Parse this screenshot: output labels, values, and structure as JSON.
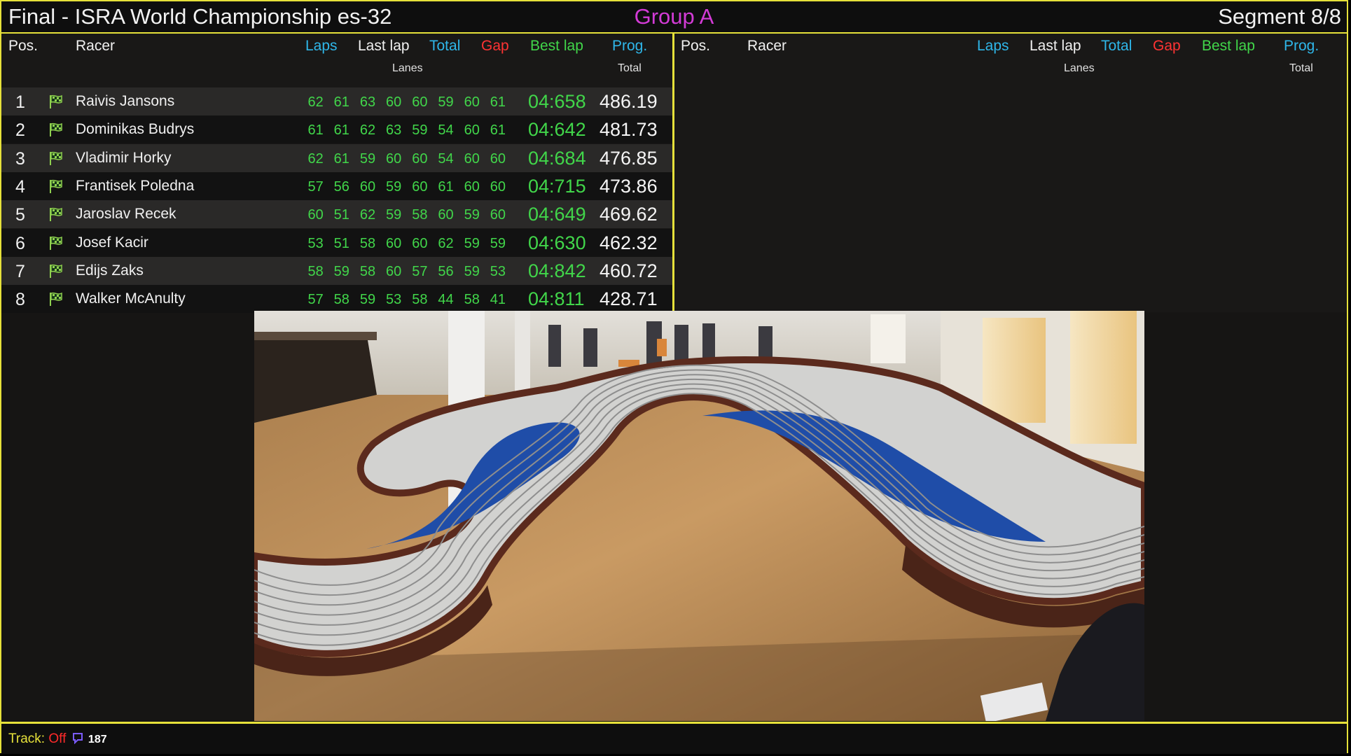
{
  "header": {
    "title": "Final - ISRA World Championship es-32",
    "group": "Group A",
    "segment": "Segment 8/8"
  },
  "columns": {
    "pos": "Pos.",
    "racer": "Racer",
    "laps": "Laps",
    "last_lap": "Last lap",
    "total": "Total",
    "gap": "Gap",
    "best_lap": "Best lap",
    "prog": "Prog.",
    "lanes": "Lanes",
    "prog_total": "Total"
  },
  "racers": [
    {
      "pos": "1",
      "name": "Raivis Jansons",
      "lanes": [
        "62",
        "61",
        "63",
        "60",
        "60",
        "59",
        "60",
        "61"
      ],
      "best_lap": "04:658",
      "total": "486.19"
    },
    {
      "pos": "2",
      "name": "Dominikas Budrys",
      "lanes": [
        "61",
        "61",
        "62",
        "63",
        "59",
        "54",
        "60",
        "61"
      ],
      "best_lap": "04:642",
      "total": "481.73"
    },
    {
      "pos": "3",
      "name": "Vladimir Horky",
      "lanes": [
        "62",
        "61",
        "59",
        "60",
        "60",
        "54",
        "60",
        "60"
      ],
      "best_lap": "04:684",
      "total": "476.85"
    },
    {
      "pos": "4",
      "name": "Frantisek Poledna",
      "lanes": [
        "57",
        "56",
        "60",
        "59",
        "60",
        "61",
        "60",
        "60"
      ],
      "best_lap": "04:715",
      "total": "473.86"
    },
    {
      "pos": "5",
      "name": "Jaroslav Recek",
      "lanes": [
        "60",
        "51",
        "62",
        "59",
        "58",
        "60",
        "59",
        "60"
      ],
      "best_lap": "04:649",
      "total": "469.62"
    },
    {
      "pos": "6",
      "name": "Josef Kacir",
      "lanes": [
        "53",
        "51",
        "58",
        "60",
        "60",
        "62",
        "59",
        "59"
      ],
      "best_lap": "04:630",
      "total": "462.32"
    },
    {
      "pos": "7",
      "name": "Edijs Zaks",
      "lanes": [
        "58",
        "59",
        "58",
        "60",
        "57",
        "56",
        "59",
        "53"
      ],
      "best_lap": "04:842",
      "total": "460.72"
    },
    {
      "pos": "8",
      "name": "Walker McAnulty",
      "lanes": [
        "57",
        "58",
        "59",
        "53",
        "58",
        "44",
        "58",
        "41"
      ],
      "best_lap": "04:811",
      "total": "428.71"
    }
  ],
  "footer": {
    "track_label": "Track:",
    "track_status": "Off",
    "chat_icon": "chat-bubble-icon",
    "count": "187"
  },
  "colors": {
    "accent": "#e6e13a",
    "group": "#d33bd6",
    "lanes": "#41d64a",
    "blue": "#2fb7ea",
    "red": "#ff3333"
  }
}
